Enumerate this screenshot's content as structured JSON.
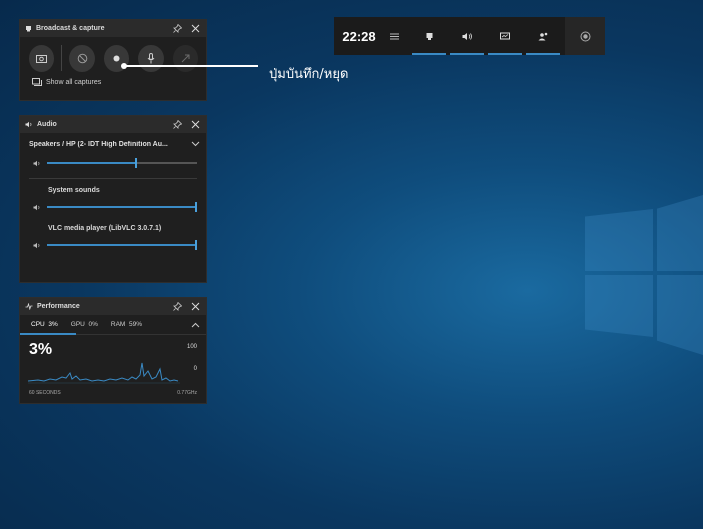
{
  "game_bar": {
    "time": "22:28",
    "icons": [
      "menu-icon",
      "broadcast-icon",
      "audio-icon",
      "performance-icon",
      "social-icon",
      "xbox-icon"
    ]
  },
  "capture_widget": {
    "title": "Broadcast & capture",
    "show_all_label": "Show all captures",
    "icons": [
      "camera-icon",
      "record-last-icon",
      "record-icon",
      "mic-icon",
      "broadcast-icon"
    ]
  },
  "audio_widget": {
    "title": "Audio",
    "device": "Speakers / HP (2- IDT High Definition Au...",
    "master_level": 0.6,
    "apps": [
      {
        "name": "System sounds",
        "level": 1.0
      },
      {
        "name": "VLC media player (LibVLC 3.0.7.1)",
        "level": 1.0
      }
    ]
  },
  "performance_widget": {
    "title": "Performance",
    "tabs": [
      {
        "label": "CPU",
        "value": "3%"
      },
      {
        "label": "GPU",
        "value": "0%"
      },
      {
        "label": "RAM",
        "value": "59%"
      }
    ],
    "big_value": "3%",
    "scale_max": "100",
    "scale_min": "0",
    "footer_left": "60 SECONDS",
    "footer_right": "0.77GHz"
  },
  "callout": {
    "text": "ปุ่มบันทึก/หยุด"
  },
  "colors": {
    "accent": "#3a8ac4",
    "panel": "#1f1f1f",
    "panel_header": "#2b2b2b"
  }
}
